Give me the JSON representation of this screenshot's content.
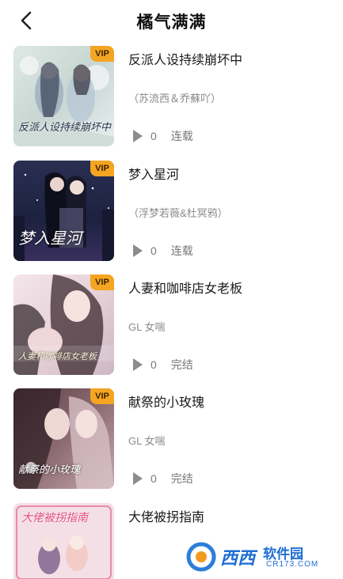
{
  "header": {
    "title": "橘气满满",
    "back_icon": "chevron-left-icon"
  },
  "colors": {
    "vip_badge": "#f4a522",
    "text_primary": "#1a1a1a",
    "text_secondary": "#8a8a8a",
    "play_icon": "#8c8c8c"
  },
  "items": [
    {
      "title": "反派人设持续崩坏中",
      "subtitle": "（苏流西＆乔蘇吖）",
      "badge": "VIP",
      "plays": "0",
      "status": "连载",
      "cover_text": "反派人设持续崩坏中"
    },
    {
      "title": "梦入星河",
      "subtitle": "（浮梦若薇&杜冥鸦）",
      "badge": "VIP",
      "plays": "0",
      "status": "连载",
      "cover_text": "梦入星河"
    },
    {
      "title": "人妻和咖啡店女老板",
      "subtitle": "GL  女喘",
      "badge": "VIP",
      "plays": "0",
      "status": "完结",
      "cover_text": "人妻和咖啡店女老板"
    },
    {
      "title": "献祭的小玫瑰",
      "subtitle": "GL  女喘",
      "badge": "VIP",
      "plays": "0",
      "status": "完结",
      "cover_text": "献祭的小玫瑰"
    },
    {
      "title": "大佬被拐指南",
      "subtitle": "",
      "badge": "",
      "plays": "",
      "status": "",
      "cover_text": "大佬被拐指南"
    }
  ],
  "watermark": {
    "brand": "西西",
    "label": "软件园",
    "site": "CR173.COM"
  }
}
